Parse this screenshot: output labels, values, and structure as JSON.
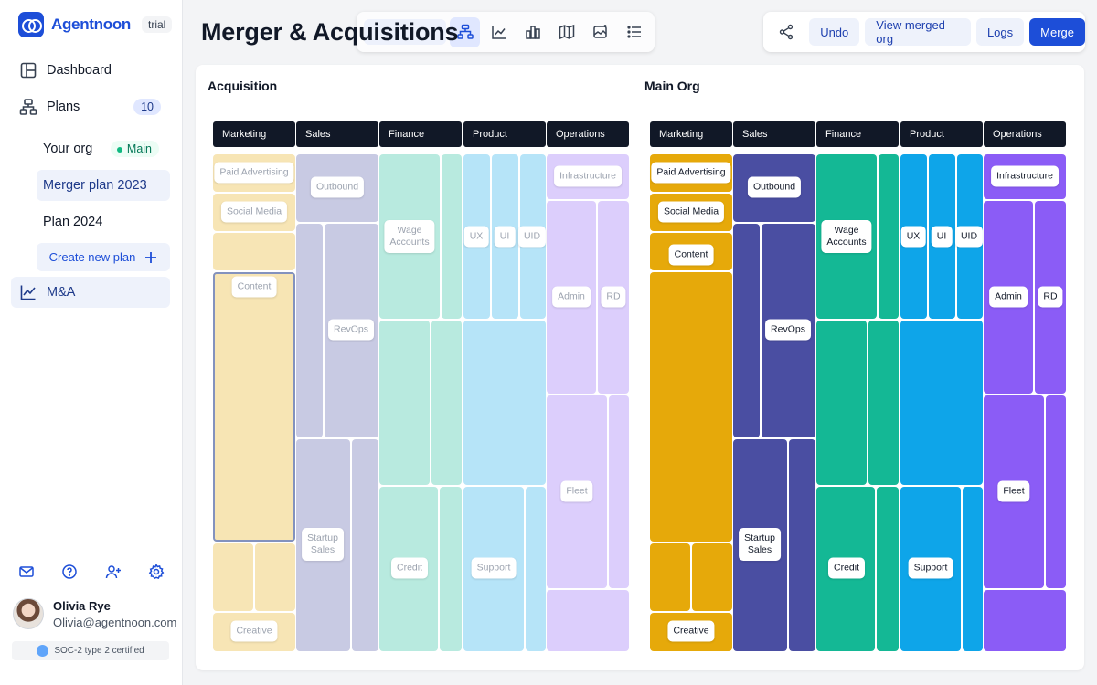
{
  "brand": {
    "name": "Agentnoon",
    "tag": "trial"
  },
  "sidebar": {
    "dashboard_label": "Dashboard",
    "plans_label": "Plans",
    "plans_count": "10",
    "plans": [
      {
        "label": "Your org",
        "badge": "Main"
      },
      {
        "label": "Merger plan 2023"
      },
      {
        "label": "Plan 2024"
      }
    ],
    "create_plan_label": "Create new plan",
    "ma_label": "M&A"
  },
  "user": {
    "name": "Olivia Rye",
    "email": "Olivia@agentnoon.com"
  },
  "compliance": "SOC-2 type 2 certified",
  "header": {
    "title": "Merger & Acquisitions"
  },
  "actions": {
    "undo": "Undo",
    "view_merged": "View merged org",
    "logs": "Logs",
    "merge": "Merge"
  },
  "colors": {
    "marketing": "#e6a90a",
    "sales": "#4a4ea2",
    "finance": "#14b895",
    "product": "#0ea5e9",
    "operations": "#8b5cf6",
    "primary": "#1d4ed8"
  },
  "columns": [
    "Marketing",
    "Sales",
    "Finance",
    "Product",
    "Operations"
  ],
  "acquisition": {
    "title": "Acquisition",
    "labels": {
      "paid_advertising": "Paid Advertising",
      "social_media": "Social Media",
      "content": "Content",
      "creative": "Creative",
      "outbound": "Outbound",
      "revops": "RevOps",
      "startup_sales": "Startup Sales",
      "wage_accounts": "Wage Accounts",
      "credit": "Credit",
      "ux": "UX",
      "ui": "UI",
      "uid": "UID",
      "support": "Support",
      "infrastructure": "Infrastructure",
      "admin": "Admin",
      "rd": "RD",
      "fleet": "Fleet"
    }
  },
  "main_org": {
    "title": "Main Org",
    "labels": {
      "paid_advertising": "Paid Advertising",
      "social_media": "Social Media",
      "content": "Content",
      "creative": "Creative",
      "outbound": "Outbound",
      "revops": "RevOps",
      "startup_sales": "Startup Sales",
      "wage_accounts": "Wage Accounts",
      "credit": "Credit",
      "ux": "UX",
      "ui": "UI",
      "uid": "UID",
      "support": "Support",
      "infrastructure": "Infrastructure",
      "admin": "Admin",
      "rd": "RD",
      "fleet": "Fleet"
    }
  }
}
